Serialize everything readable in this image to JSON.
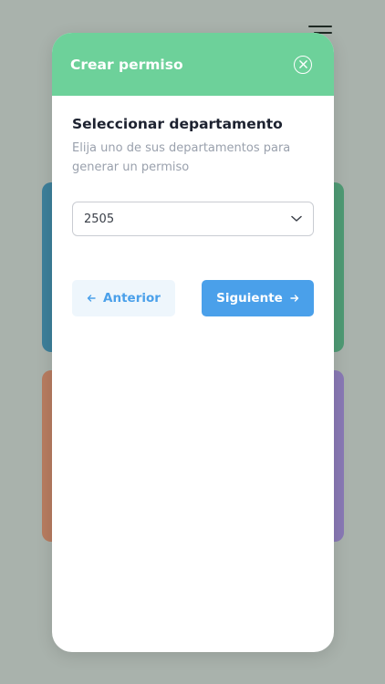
{
  "modal": {
    "title": "Crear permiso",
    "section_title": "Seleccionar departamento",
    "section_description": "Elija uno de sus departamentos para generar un permiso",
    "department_select": {
      "value": "2505"
    },
    "prev_label": "Anterior",
    "next_label": "Siguiente"
  },
  "icons": {
    "menu": "hamburger-menu-icon",
    "close": "close-circle-icon",
    "select": "chevron-down-icon",
    "prev": "arrow-left-icon",
    "next": "arrow-right-icon"
  },
  "colors": {
    "background": "#a9b2ac",
    "header": "#6dd19a",
    "primary": "#4aa0ea",
    "primary_light": "#eef6fc",
    "card_blue": "#3d7f9a",
    "card_green": "#4f9a74",
    "card_orange": "#b77c60",
    "card_purple": "#8979b5"
  }
}
